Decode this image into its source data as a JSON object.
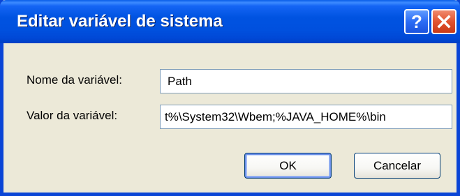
{
  "window": {
    "title": "Editar variável de sistema",
    "help_label": "?"
  },
  "form": {
    "name_label": "Nome da variável:",
    "name_value": "Path",
    "value_label": "Valor da variável:",
    "value_value": "t%\\System32\\Wbem;%JAVA_HOME%\\bin"
  },
  "buttons": {
    "ok_label": "OK",
    "cancel_label": "Cancelar"
  },
  "icons": {
    "help": "help-icon",
    "close": "close-icon"
  },
  "colors": {
    "titlebar": "#0053e1",
    "dialog_bg": "#ece9d8",
    "close_button": "#e2532f",
    "field_border": "#7f9db9"
  }
}
